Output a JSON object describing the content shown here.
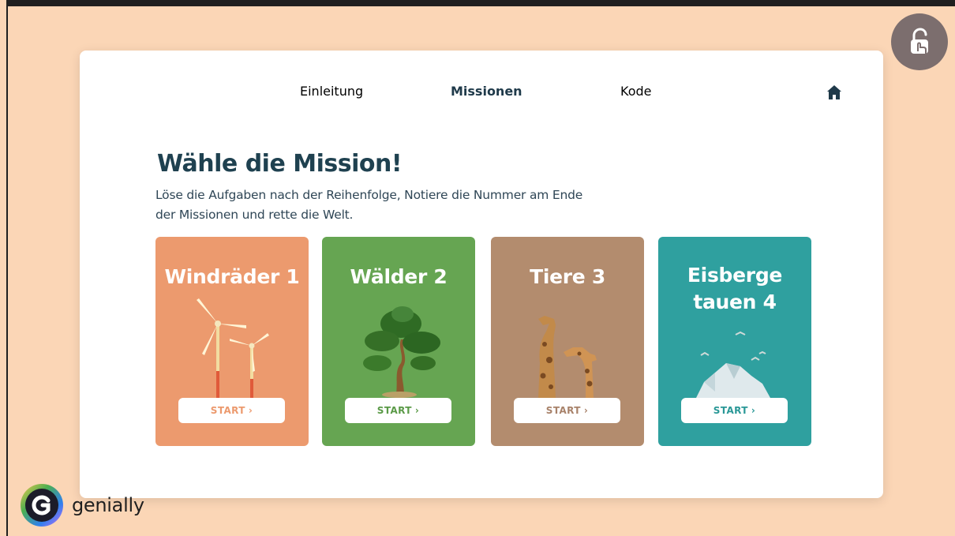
{
  "nav": {
    "items": [
      {
        "label": "Einleitung"
      },
      {
        "label": "Missionen"
      },
      {
        "label": "Kode"
      }
    ],
    "active": "Missionen",
    "home_icon": "home-icon"
  },
  "heading": {
    "title": "Wähle die Mission!",
    "description": "Löse die Aufgaben nach der Reihenfolge, Notiere die Nummer am Ende der Missionen und rette die Welt."
  },
  "missions": [
    {
      "title": "Windräder 1",
      "button": "START",
      "color": "#ec9a6e",
      "illustration": "wind-turbines"
    },
    {
      "title": "Wälder 2",
      "button": "START",
      "color": "#66a552",
      "illustration": "tree"
    },
    {
      "title": "Tiere 3",
      "button": "START",
      "color": "#b38c6e",
      "illustration": "giraffes"
    },
    {
      "title": "Eisberge tauen 4",
      "button": "START",
      "color": "#2fa09f",
      "illustration": "iceberg-birds"
    }
  ],
  "brand": {
    "name": "genially"
  },
  "lock_icon": "unlock-hand-icon"
}
